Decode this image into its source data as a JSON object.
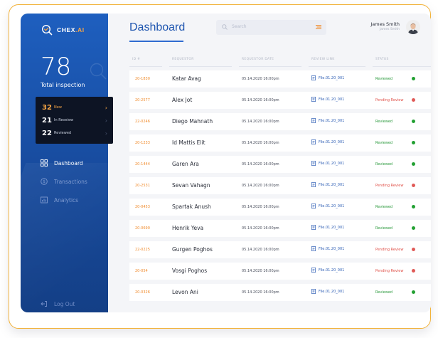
{
  "app": {
    "logo_text": "CHEX",
    "logo_accent": ".AI"
  },
  "sidebar": {
    "total_value": "78",
    "total_label": "Total inspection",
    "counts": [
      {
        "value": "32",
        "label": "New",
        "active": true
      },
      {
        "value": "21",
        "label": "In Reveiew",
        "active": false
      },
      {
        "value": "22",
        "label": "Reviewed",
        "active": false
      }
    ],
    "nav": [
      {
        "label": "Dashboard",
        "icon": "grid-icon",
        "active": true
      },
      {
        "label": "Transactions",
        "icon": "dollar-circle-icon",
        "active": false
      },
      {
        "label": "Analytics",
        "icon": "analytics-icon",
        "active": false
      }
    ],
    "logout_label": "Log Out"
  },
  "header": {
    "title": "Dashboard",
    "search_placeholder": "Search",
    "user_name": "James Smith",
    "user_role": "James Smith"
  },
  "table": {
    "columns": [
      "ID #",
      "REQUESTOR",
      "REQUESTOR DATE",
      "REVIEW LINK",
      "STATUS"
    ],
    "rows": [
      {
        "id": "20-1830",
        "requestor": "Katar Avag",
        "date": "05.14.2020 16:00pm",
        "link": "File.01.20_001",
        "status": "Reviewed"
      },
      {
        "id": "20-2577",
        "requestor": "Alex Jot",
        "date": "05.14.2020 16:00pm",
        "link": "File.01.20_001",
        "status": "Pending Review"
      },
      {
        "id": "22-0246",
        "requestor": "Diego Mahnath",
        "date": "05.14.2020 16:00pm",
        "link": "File.01.20_001",
        "status": "Reviewed"
      },
      {
        "id": "20-1233",
        "requestor": "Id Mattis Elit",
        "date": "05.14.2020 16:00pm",
        "link": "File.01.20_001",
        "status": "Reviewed"
      },
      {
        "id": "20-1444",
        "requestor": "Garen Ara",
        "date": "05.14.2020 16:00pm",
        "link": "File.01.20_001",
        "status": "Reviewed"
      },
      {
        "id": "20-2531",
        "requestor": "Sevan Vahagn",
        "date": "05.14.2020 16:00pm",
        "link": "File.01.20_001",
        "status": "Pending Review"
      },
      {
        "id": "20-0453",
        "requestor": "Spartak Anush",
        "date": "05.14.2020 16:00pm",
        "link": "File.01.20_001",
        "status": "Reviewed"
      },
      {
        "id": "20-0690",
        "requestor": "Henrik Yeva",
        "date": "05.14.2020 16:00pm",
        "link": "File.01.20_001",
        "status": "Reviewed"
      },
      {
        "id": "22-0225",
        "requestor": "Gurgen Poghos",
        "date": "05.14.2020 16:00pm",
        "link": "File.01.20_001",
        "status": "Pending Review"
      },
      {
        "id": "20-054",
        "requestor": "Vosgi Poghos",
        "date": "05.14.2020 16:00pm",
        "link": "File.01.20_001",
        "status": "Pending Review"
      },
      {
        "id": "20-0326",
        "requestor": "Levon Ani",
        "date": "05.14.2020 16:00pm",
        "link": "File.01.20_001",
        "status": "Reviewed"
      }
    ]
  },
  "colors": {
    "brand_blue": "#1e5fbf",
    "accent_orange": "#f7a545",
    "reviewed_green": "#2b9a3d",
    "pending_red": "#e0524a"
  }
}
